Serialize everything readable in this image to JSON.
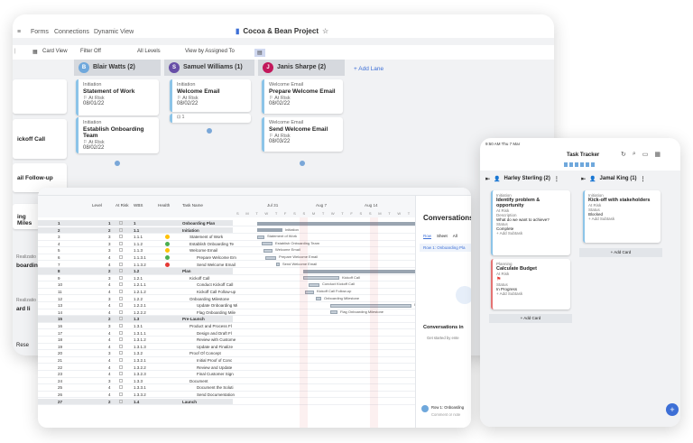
{
  "board": {
    "nav": [
      "Forms",
      "Connections",
      "Dynamic View"
    ],
    "title": "Cocoa & Bean Project",
    "toolbar": [
      "Card View",
      "Filter Off",
      "All Levels",
      "View by Assigned To"
    ],
    "lanes": [
      {
        "initial": "B",
        "name": "Blair Watts (2)",
        "color": "#6fa8dc"
      },
      {
        "initial": "S",
        "name": "Samuel Williams (1)",
        "color": "#674ea7"
      },
      {
        "initial": "J",
        "name": "Janis Sharpe (2)",
        "color": "#c2185b"
      }
    ],
    "add_lane": "+ Add Lane",
    "left_cut": [
      "ickoff Call",
      "ail Follow-up",
      "ing Miles",
      "Realizatio",
      "boardin",
      "Realizatio",
      "ard li",
      "Rese"
    ],
    "cards": [
      {
        "cat": "Initiation",
        "title": "Statement of Work",
        "risk": "At Risk",
        "date": "08/01/22"
      },
      {
        "cat": "Initiation",
        "title": "Establish Onboarding Team",
        "risk": "At Risk",
        "date": "08/02/22"
      },
      {
        "cat": "Initiation",
        "title": "Welcome Email",
        "risk": "At Risk",
        "date": "08/02/22"
      },
      {
        "cat": "Welcome Email",
        "title": "Prepare Welcome Email",
        "risk": "At Risk",
        "date": "08/02/22"
      },
      {
        "cat": "Welcome Email",
        "title": "Send Welcome Email",
        "risk": "At Risk",
        "date": "08/03/22"
      }
    ],
    "sub_count": "1"
  },
  "gantt": {
    "headers": [
      "Level",
      "At Risk",
      "WBS",
      "Health",
      "Task Name"
    ],
    "months": [
      "Jul 31",
      "Aug 7",
      "Aug 14"
    ],
    "days": "S M T W T F S S M T W T F S S M T W T F S S M",
    "rows": [
      {
        "n": "1",
        "lvl": "1",
        "wbs": "1",
        "h": "",
        "task": "Onboarding Plan"
      },
      {
        "n": "2",
        "lvl": "2",
        "wbs": "1.1",
        "h": "",
        "task": "Initiation"
      },
      {
        "n": "3",
        "lvl": "3",
        "wbs": "1.1.1",
        "h": "#ffc107",
        "task": "Statement of Work"
      },
      {
        "n": "4",
        "lvl": "3",
        "wbs": "1.1.2",
        "h": "#4caf50",
        "task": "Establish Onboarding Te"
      },
      {
        "n": "5",
        "lvl": "3",
        "wbs": "1.1.3",
        "h": "#ffc107",
        "task": "Welcome Email"
      },
      {
        "n": "6",
        "lvl": "4",
        "wbs": "1.1.3.1",
        "h": "#4caf50",
        "task": "Prepare Welcome Em"
      },
      {
        "n": "7",
        "lvl": "4",
        "wbs": "1.1.3.2",
        "h": "#e53935",
        "task": "Send Welcome Email"
      },
      {
        "n": "8",
        "lvl": "2",
        "wbs": "1.2",
        "h": "",
        "task": "Plan"
      },
      {
        "n": "9",
        "lvl": "3",
        "wbs": "1.2.1",
        "h": "",
        "task": "Kickoff Call"
      },
      {
        "n": "10",
        "lvl": "4",
        "wbs": "1.2.1.1",
        "h": "",
        "task": "Conduct Kickoff Call"
      },
      {
        "n": "11",
        "lvl": "4",
        "wbs": "1.2.1.2",
        "h": "",
        "task": "Kickoff Call Follow-up"
      },
      {
        "n": "12",
        "lvl": "3",
        "wbs": "1.2.2",
        "h": "",
        "task": "Onboarding Milestone"
      },
      {
        "n": "13",
        "lvl": "4",
        "wbs": "1.2.2.1",
        "h": "",
        "task": "Update Onboarding Mi"
      },
      {
        "n": "14",
        "lvl": "4",
        "wbs": "1.2.2.2",
        "h": "",
        "task": "Flag Onboarding Mile"
      },
      {
        "n": "15",
        "lvl": "2",
        "wbs": "1.3",
        "h": "",
        "task": "Pre-Launch"
      },
      {
        "n": "16",
        "lvl": "3",
        "wbs": "1.3.1",
        "h": "",
        "task": "Product and Process Fl"
      },
      {
        "n": "17",
        "lvl": "4",
        "wbs": "1.3.1.1",
        "h": "",
        "task": "Design and Draft Fl"
      },
      {
        "n": "18",
        "lvl": "4",
        "wbs": "1.3.1.2",
        "h": "",
        "task": "Review with Custome"
      },
      {
        "n": "19",
        "lvl": "4",
        "wbs": "1.3.1.3",
        "h": "",
        "task": "Update and Finalize"
      },
      {
        "n": "20",
        "lvl": "3",
        "wbs": "1.3.2",
        "h": "",
        "task": "Proof Of Concept"
      },
      {
        "n": "21",
        "lvl": "4",
        "wbs": "1.3.2.1",
        "h": "",
        "task": "Initial Proof of Conc"
      },
      {
        "n": "22",
        "lvl": "4",
        "wbs": "1.3.2.2",
        "h": "",
        "task": "Review and Update"
      },
      {
        "n": "23",
        "lvl": "4",
        "wbs": "1.3.2.3",
        "h": "",
        "task": "Final Customer Sign"
      },
      {
        "n": "24",
        "lvl": "3",
        "wbs": "1.3.3",
        "h": "",
        "task": "Document"
      },
      {
        "n": "25",
        "lvl": "4",
        "wbs": "1.3.3.1",
        "h": "",
        "task": "Document the Soluti"
      },
      {
        "n": "26",
        "lvl": "4",
        "wbs": "1.3.3.2",
        "h": "",
        "task": "Send Documentation"
      },
      {
        "n": "27",
        "lvl": "2",
        "wbs": "1.4",
        "h": "",
        "task": "Launch"
      }
    ],
    "bar_labels": [
      "Initiation",
      "Statement of Work",
      "Establish Onboarding Team",
      "Welcome Email",
      "Prepare Welcome Email",
      "Send Welcome Email",
      "Plan",
      "Kickoff Call",
      "Conduct Kickoff Call",
      "Kickoff Call Follow-up",
      "Onboarding Milestone",
      "Update Onboarding Milestone",
      "Flag Onboarding Milestone"
    ],
    "conv": {
      "title": "Conversations",
      "tabs": [
        "Row",
        "Sheet",
        "All"
      ],
      "row_label": "Row 1: Onboarding Pla",
      "empty": "Conversations in",
      "hint": "Get started by ente",
      "comment_row": "Row 1: Onboarding",
      "comment_hint": "Comment or note"
    }
  },
  "tablet": {
    "status": "9:50 AM  Thu 7 Mar",
    "title": "Task Tracker",
    "lanes": [
      {
        "name": "Harley Sterling (2)"
      },
      {
        "name": "Jamal King (1)"
      }
    ],
    "cards": [
      {
        "cat": "Initiation",
        "title": "Identify problem & opportunity",
        "risk": "At Risk",
        "f1l": "Description",
        "f1": "What do we want to achieve?",
        "f2l": "Status",
        "f2": "Complete",
        "add": "+ Add Subtask"
      },
      {
        "cat": "Initiation",
        "title": "Kick-off with stakeholders",
        "risk": "At Risk",
        "f2l": "Status",
        "f2": "Blocked",
        "add": "+ Add Subtask"
      },
      {
        "cat": "Planning",
        "title": "Calculate Budget",
        "risk": "At Risk",
        "f2l": "Status",
        "f2": "In Progress",
        "add": "+ Add Subtask"
      }
    ],
    "add_card": "+ Add Card"
  }
}
